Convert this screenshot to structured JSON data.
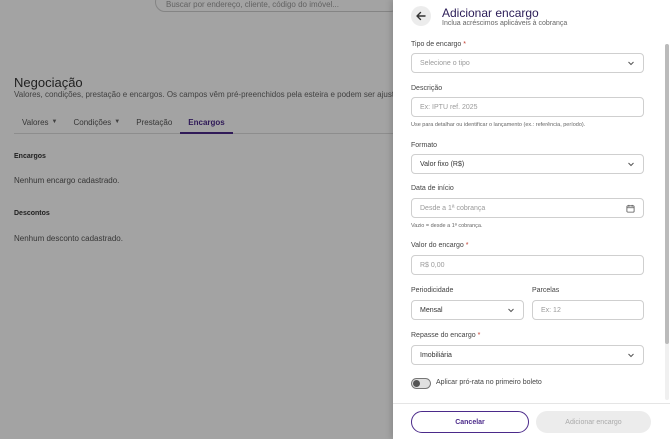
{
  "background": {
    "search_placeholder": "Buscar por endereço, cliente, código do imóvel...",
    "title": "Negociação",
    "subtitle": "Valores, condições, prestação e encargos. Os campos vêm pré-preenchidos pela esteira e podem ser ajustados.",
    "tabs": [
      {
        "label": "Valores",
        "caret": "▼"
      },
      {
        "label": "Condições",
        "caret": "▼"
      },
      {
        "label": "Prestação",
        "caret": ""
      },
      {
        "label": "Encargos",
        "caret": ""
      }
    ],
    "sections": {
      "charges_title": "Encargos",
      "charges_empty": "Nenhum encargo cadastrado.",
      "discounts_title": "Descontos",
      "discounts_empty": "Nenhum desconto cadastrado."
    }
  },
  "drawer": {
    "title": "Adicionar encargo",
    "subtitle": "Inclua acréscimos aplicáveis à cobrança",
    "fields": {
      "charge_type": {
        "label": "Tipo de encargo",
        "required_mark": "*",
        "placeholder": "Selecione o tipo"
      },
      "description": {
        "label": "Descrição",
        "placeholder": "Ex: IPTU ref. 2025",
        "help": "Use para detalhar ou identificar o lançamento (ex.: referência, período)."
      },
      "format": {
        "label": "Formato",
        "value": "Valor fixo (R$)"
      },
      "start_date": {
        "label": "Data de início",
        "placeholder": "Desde a 1ª cobrança",
        "help": "Vazio = desde a 1ª cobrança."
      },
      "amount": {
        "label": "Valor do encargo",
        "required_mark": "*",
        "placeholder": "R$ 0,00"
      },
      "periodicity": {
        "label": "Periodicidade",
        "value": "Mensal"
      },
      "installments": {
        "label": "Parcelas",
        "placeholder": "Ex: 12"
      },
      "pass_through": {
        "label": "Repasse do encargo",
        "required_mark": "*",
        "value": "Imobiliária"
      }
    },
    "toggle_label": "Aplicar pró-rata no primeiro boleto",
    "cancel_label": "Cancelar",
    "submit_label": "Adicionar encargo"
  },
  "colors": {
    "accent": "#4b2a8a",
    "required": "#c0392b"
  }
}
